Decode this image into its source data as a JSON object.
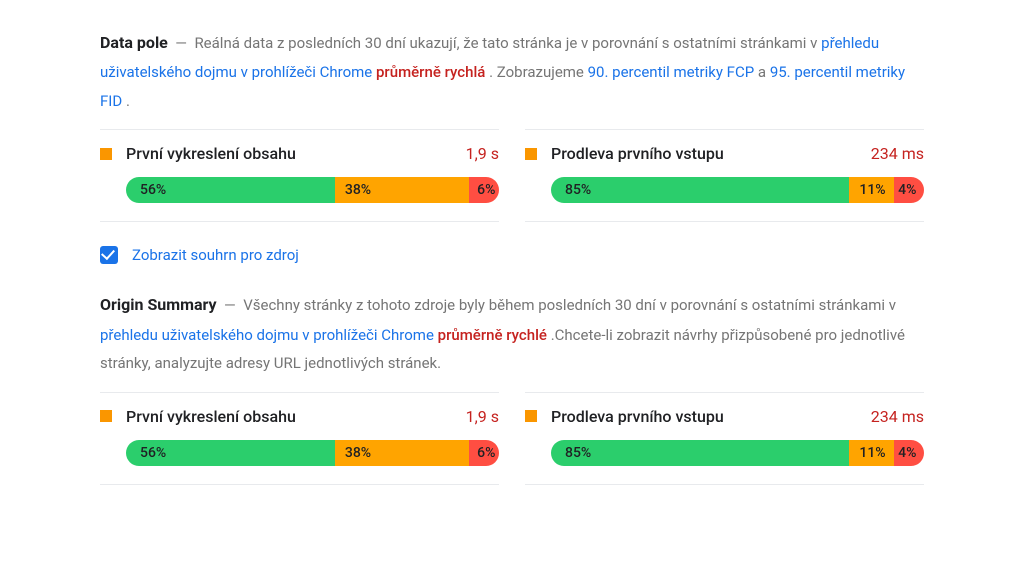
{
  "field": {
    "title": "Data pole",
    "desc1": "Reálná data z posledních 30 dní ukazují, že tato stránka je v porovnání s ostatními stránkami v ",
    "link1": "přehledu uživatelského dojmu v prohlížeči Chrome",
    "emph": "průměrně rychlá",
    "desc2": ". Zobrazujeme ",
    "link2": "90. percentil metriky FCP",
    "and": " a ",
    "link3": "95. percentil metriky FID",
    "tail": "."
  },
  "origin": {
    "title": "Origin Summary",
    "desc1": "Všechny stránky z tohoto zdroje byly během posledních 30 dní v porovnání s ostatními stránkami v ",
    "link1": "přehledu uživatelského dojmu v prohlížeči Chrome",
    "emph": "průměrně rychlé",
    "desc2": ".Chcete-li zobrazit návrhy přizpůsobené pro jednotlivé stránky, analyzujte adresy URL jednotlivých stránek."
  },
  "checkbox_label": "Zobrazit souhrn pro zdroj",
  "metrics": {
    "fcp": {
      "name": "První vykreslení obsahu",
      "value": "1,9 s",
      "g": "56%",
      "o": "38%",
      "r": "6%",
      "gw": "56%",
      "ow": "36%",
      "rw": "8%"
    },
    "fid": {
      "name": "Prodleva prvního vstupu",
      "value": "234 ms",
      "g": "85%",
      "o": "11%",
      "r": "4%",
      "gw": "80%",
      "ow": "12%",
      "rw": "8%"
    }
  }
}
